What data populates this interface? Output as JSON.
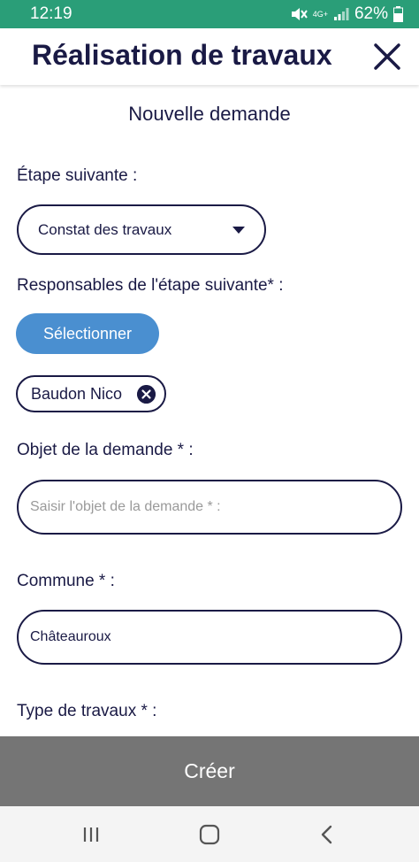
{
  "status_bar": {
    "time": "12:19",
    "network": "4G+",
    "battery": "62%",
    "icons": [
      "mute-icon",
      "network-icon",
      "signal-icon",
      "battery-icon"
    ]
  },
  "header": {
    "title": "Réalisation de travaux",
    "close_icon": "close-icon"
  },
  "form": {
    "subtitle": "Nouvelle demande",
    "next_step_label": "Étape suivante :",
    "next_step_value": "Constat des travaux",
    "responsables_label": "Responsables de l'étape suivante* :",
    "select_button": "Sélectionner",
    "selected_people": [
      {
        "name": "Baudon Nico"
      }
    ],
    "objet_label": "Objet de la demande * :",
    "objet_placeholder": "Saisir l'objet de la demande * :",
    "objet_value": "",
    "commune_label": "Commune * :",
    "commune_value": "Châteauroux",
    "type_label": "Type de travaux * :"
  },
  "footer": {
    "create_button": "Créer"
  },
  "nav_bar": {
    "icons": [
      "recent-apps-icon",
      "home-icon",
      "back-icon"
    ]
  },
  "colors": {
    "status_bar": "#2a9e78",
    "primary_text": "#1a1a45",
    "accent_button": "#4a8fd0",
    "create_bar": "#757575"
  }
}
